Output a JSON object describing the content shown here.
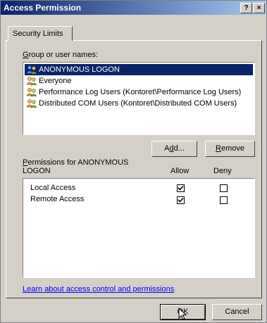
{
  "window": {
    "title": "Access Permission",
    "help_label": "?",
    "close_label": "×"
  },
  "tab": {
    "label": "Security Limits"
  },
  "group_section": {
    "label_mnemonic": "G",
    "label_rest": "roup or user names:",
    "users": [
      {
        "name": "ANONYMOUS LOGON",
        "selected": true
      },
      {
        "name": "Everyone",
        "selected": false
      },
      {
        "name": "Performance Log Users (Kontoret\\Performance Log Users)",
        "selected": false
      },
      {
        "name": "Distributed COM Users (Kontoret\\Distributed COM Users)",
        "selected": false
      }
    ],
    "add_button": {
      "pre": "A",
      "mnemonic": "d",
      "post": "d..."
    },
    "remove_button": {
      "mnemonic": "R",
      "post": "emove"
    }
  },
  "permissions": {
    "label_mnemonic": "P",
    "label_rest": "ermissions for ANONYMOUS",
    "label_line2": "LOGON",
    "allow_header": "Allow",
    "deny_header": "Deny",
    "rows": [
      {
        "name": "Local Access",
        "allow": true,
        "deny": false
      },
      {
        "name": "Remote Access",
        "allow": true,
        "deny": false
      }
    ]
  },
  "link_text": "Learn about access control and permissions",
  "footer": {
    "ok_label": "OK",
    "cancel_label": "Cancel"
  },
  "colors": {
    "title_start": "#0a246a",
    "title_end": "#a6caf0",
    "selection": "#0a246a",
    "dialog_bg": "#d4d0c8",
    "link": "#0000ff"
  }
}
